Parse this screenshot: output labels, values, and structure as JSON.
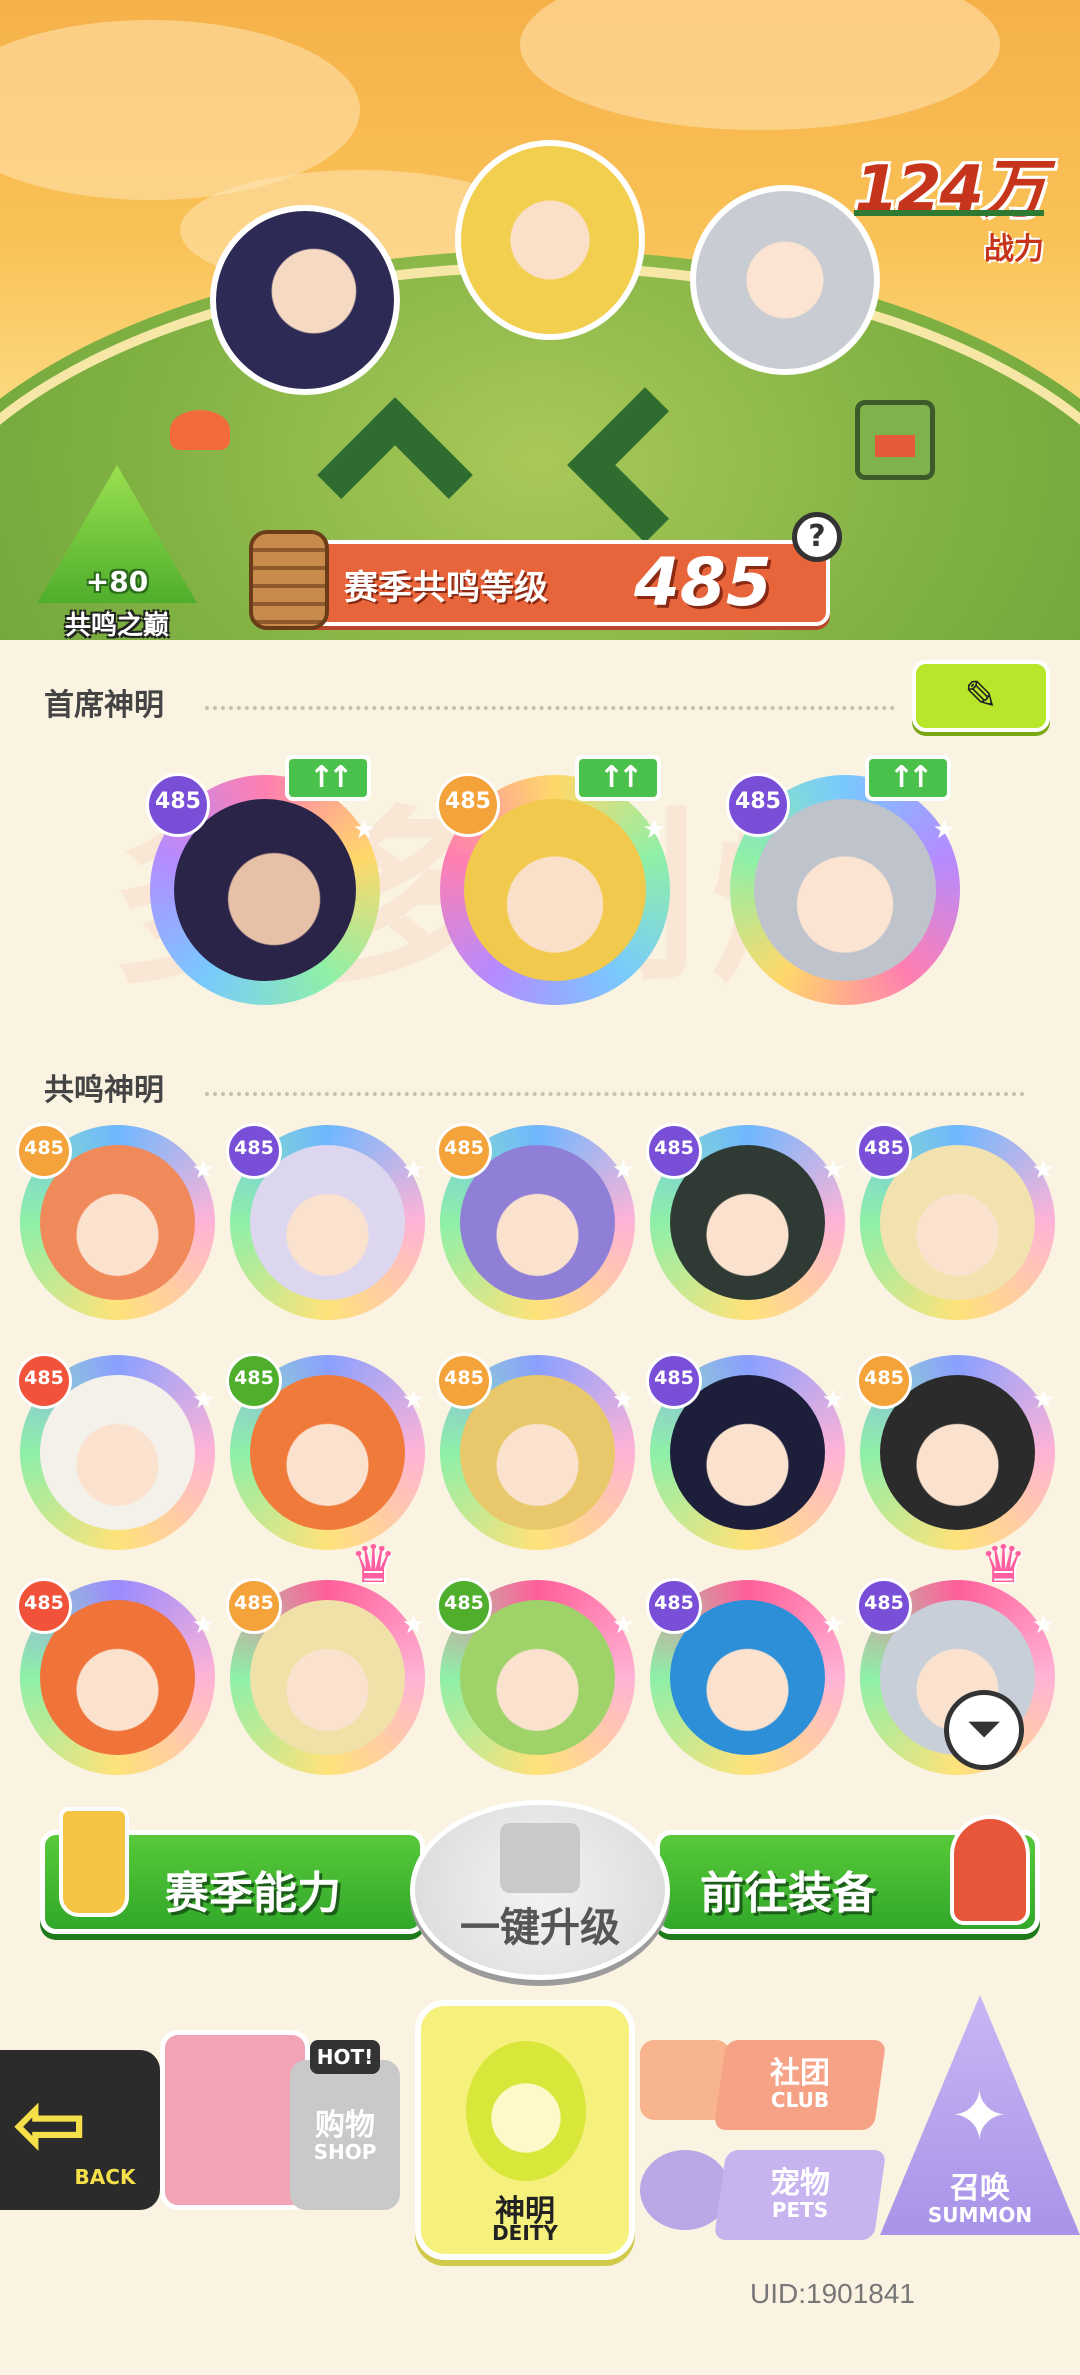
{
  "power": {
    "value": "124万",
    "label": "战力"
  },
  "peak": {
    "bonus": "+80",
    "label": "共鸣之巅"
  },
  "resonance_level": {
    "label": "赛季共鸣等级",
    "value": "485"
  },
  "help_icon": "question-icon",
  "sections": {
    "chief": "首席神明",
    "resonance": "共鸣神明"
  },
  "edit_icon": "edit-pencil-icon",
  "watermark": "多多到爆",
  "chief_deities": [
    {
      "level": "485",
      "upgrade": "↑↑"
    },
    {
      "level": "485",
      "upgrade": "↑↑"
    },
    {
      "level": "485",
      "upgrade": "↑↑"
    }
  ],
  "resonance_deities": [
    {
      "level": "485"
    },
    {
      "level": "485"
    },
    {
      "level": "485"
    },
    {
      "level": "485"
    },
    {
      "level": "485"
    },
    {
      "level": "485"
    },
    {
      "level": "485"
    },
    {
      "level": "485"
    },
    {
      "level": "485"
    },
    {
      "level": "485"
    },
    {
      "level": "485"
    },
    {
      "level": "485"
    },
    {
      "level": "485"
    },
    {
      "level": "485"
    },
    {
      "level": "485"
    }
  ],
  "filter_icon": "filter-icon",
  "actions": {
    "season_ability": "赛季能力",
    "one_key_upgrade": "一键升级",
    "go_equipment": "前往装备"
  },
  "nav": {
    "back": "BACK",
    "shop": "购物",
    "shop_en": "SHOP",
    "shop_badge": "HOT!",
    "deity": "神明",
    "deity_en": "DEITY",
    "club": "社团",
    "club_en": "CLUB",
    "pets": "宠物",
    "pets_en": "PETS",
    "summon": "召唤",
    "summon_en": "SUMMON"
  },
  "uid": "UID:1901841"
}
